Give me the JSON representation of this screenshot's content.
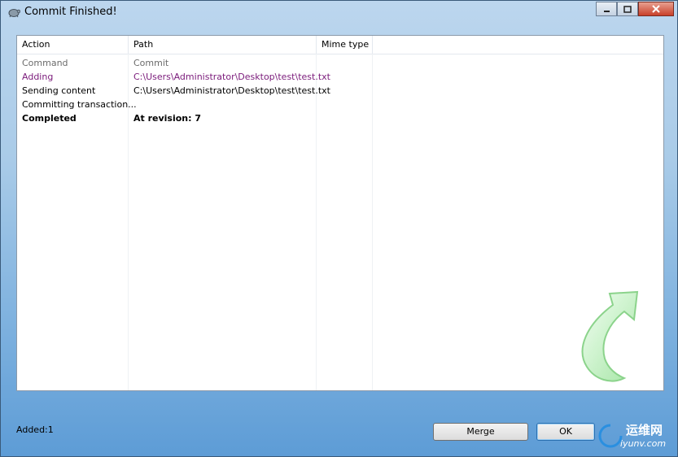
{
  "window": {
    "title": "Commit Finished!"
  },
  "columns": [
    "Action",
    "Path",
    "Mime type"
  ],
  "rows": [
    {
      "action": "Command",
      "path": "Commit",
      "style": "gray"
    },
    {
      "action": "Adding",
      "path": "C:\\Users\\Administrator\\Desktop\\test\\test.txt",
      "style": "purple"
    },
    {
      "action": "Sending content",
      "path": "C:\\Users\\Administrator\\Desktop\\test\\test.txt",
      "style": "normal"
    },
    {
      "action": "Committing transaction...",
      "path": "",
      "style": "normal"
    },
    {
      "action": "Completed",
      "path": "At revision: 7",
      "style": "bold"
    }
  ],
  "status": {
    "text": "Added:1"
  },
  "buttons": {
    "merge": "Merge",
    "ok": "OK"
  },
  "watermark": {
    "brand": "运维网",
    "url": "iyunv.com"
  },
  "colors": {
    "added_text": "#7a1a7a",
    "info_text": "#6b6b6b"
  }
}
